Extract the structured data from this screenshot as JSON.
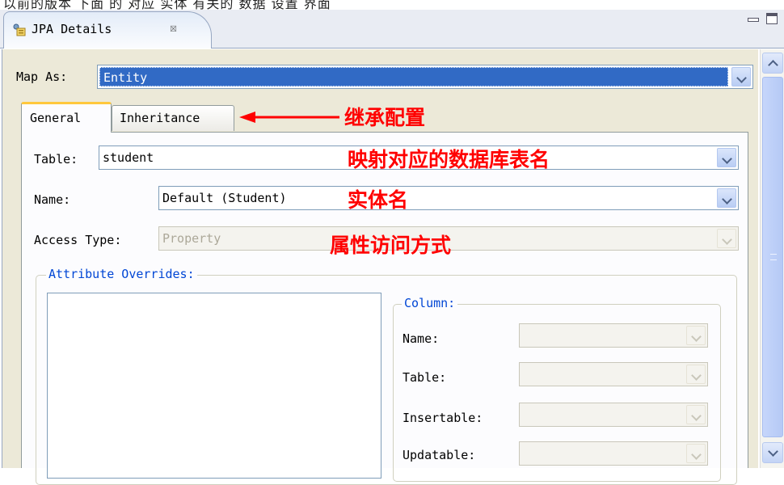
{
  "top_caption": "以前的版本 下面 的 对应 实体 有关的 数据 设置 界面",
  "view": {
    "title": "JPA Details",
    "close_glyph": "☒"
  },
  "map_as": {
    "label": "Map As:",
    "value": "Entity"
  },
  "tabs": [
    {
      "label": "General",
      "selected": true
    },
    {
      "label": "Inheritance",
      "selected": false
    }
  ],
  "fields": {
    "table": {
      "label": "Table:",
      "value": "student"
    },
    "name": {
      "label": "Name:",
      "value": "Default (Student)"
    },
    "access_type": {
      "label": "Access Type:",
      "value": "Property",
      "enabled": false
    }
  },
  "attribute_overrides": {
    "legend": "Attribute Overrides:",
    "column": {
      "legend": "Column:",
      "fields": [
        {
          "label": "Name:"
        },
        {
          "label": "Table:"
        },
        {
          "label": "Insertable:"
        },
        {
          "label": "Updatable:"
        }
      ]
    }
  },
  "annotations": {
    "inheritance": "继承配置",
    "table": "映射对应的数据库表名",
    "name": "实体名",
    "access": "属性访问方式"
  },
  "colors": {
    "annotation": "#ff0000",
    "selection": "#316ac5",
    "legend": "#0046d5",
    "tab_accent": "#ffc83c"
  },
  "icons": {
    "view_tab": "jpa-details-icon",
    "close": "close-icon",
    "minimize": "minimize-icon",
    "maximize": "maximize-icon"
  }
}
